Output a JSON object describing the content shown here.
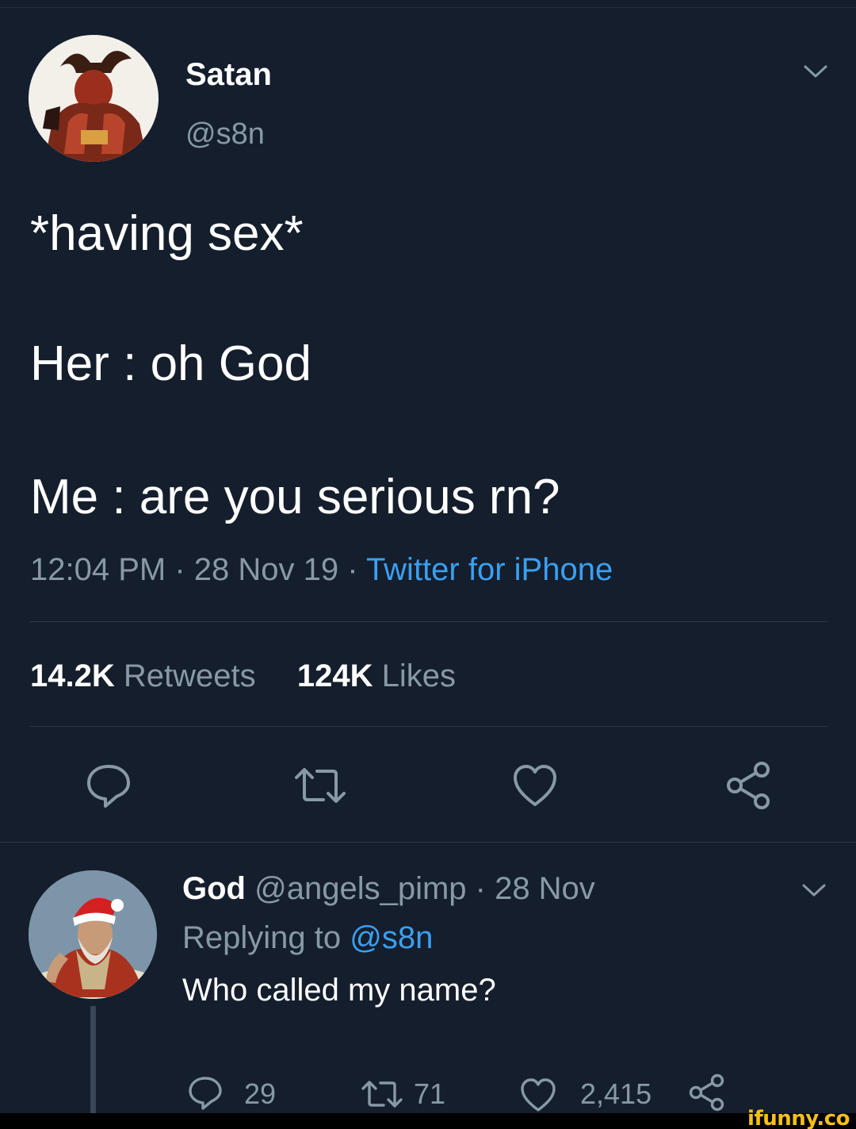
{
  "tweet": {
    "author_name": "Satan",
    "author_handle": "@s8n",
    "lines": [
      "*having sex*",
      "Her : oh God",
      "Me : are you serious rn?"
    ],
    "timestamp": "12:04 PM · 28 Nov 19 · ",
    "source": "Twitter for iPhone",
    "retweets_count": "14.2K",
    "retweets_label": " Retweets",
    "likes_count": "124K",
    "likes_label": " Likes",
    "actions": [
      "reply-icon",
      "retweet-icon",
      "like-icon",
      "share-icon"
    ]
  },
  "reply": {
    "author_name": "God",
    "author_handle": " @angels_pimp · 28 Nov",
    "replying_prefix": "Replying to ",
    "replying_to": "@s8n",
    "text": "Who called my name?",
    "reply_count": "29",
    "retweet_count": "71",
    "like_count": "2,415"
  },
  "watermark": "ifunny.co",
  "colors": {
    "background": "#151e2c",
    "secondary_text": "#8899a6",
    "link": "#3aa0f2",
    "watermark": "#f6c018"
  }
}
